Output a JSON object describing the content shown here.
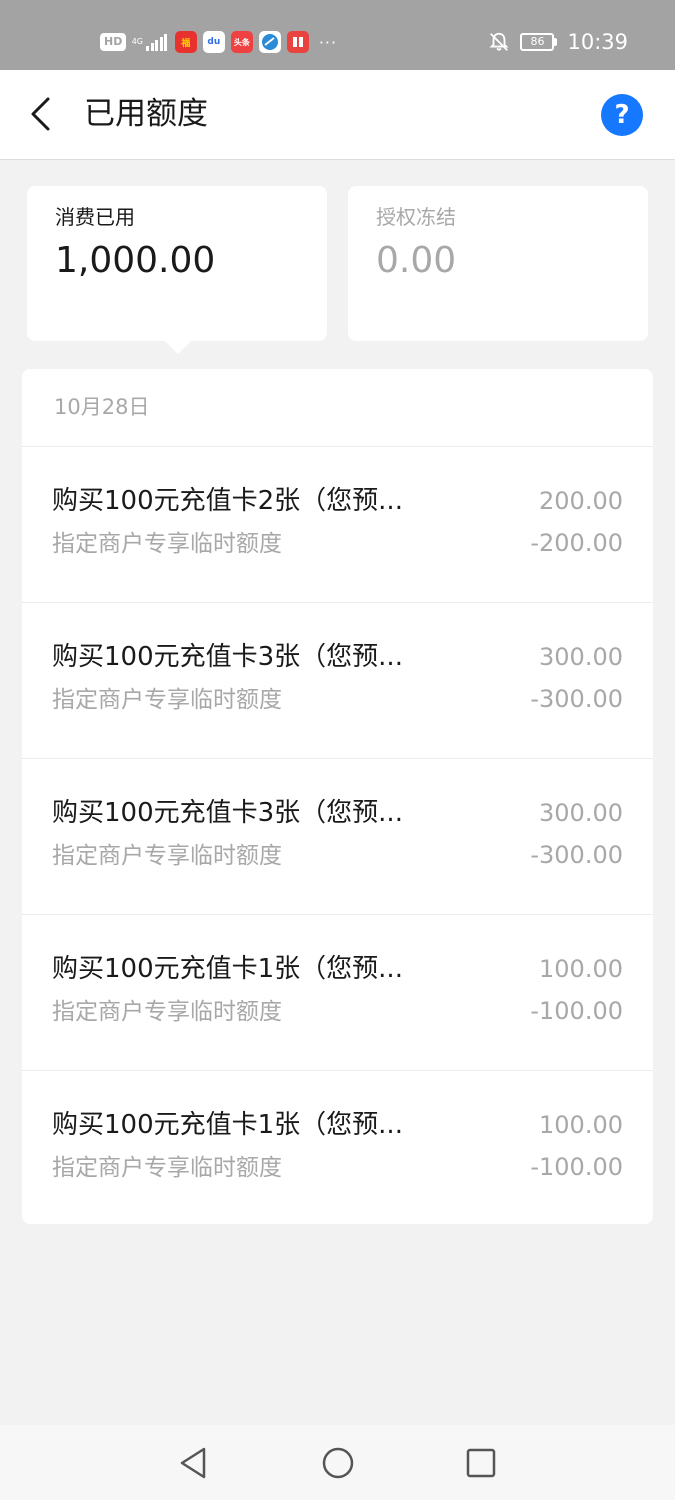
{
  "status_bar": {
    "hd": "HD",
    "network": "4G",
    "app_icons": [
      "red-app-icon",
      "baidu-icon",
      "toutiao-icon",
      "browser-icon",
      "reader-icon"
    ],
    "more": "···",
    "battery": "86",
    "time": "10:39"
  },
  "header": {
    "title": "已用额度",
    "help": "?"
  },
  "summary": {
    "used_label": "消费已用",
    "used_amount": "1,000.00",
    "frozen_label": "授权冻结",
    "frozen_amount": "0.00"
  },
  "list": {
    "date": "10月28日",
    "items": [
      {
        "name": "购买100元充值卡2张（您预...",
        "sub": "指定商户专享临时额度",
        "amount": "200.00",
        "limit_change": "-200.00"
      },
      {
        "name": "购买100元充值卡3张（您预...",
        "sub": "指定商户专享临时额度",
        "amount": "300.00",
        "limit_change": "-300.00"
      },
      {
        "name": "购买100元充值卡3张（您预...",
        "sub": "指定商户专享临时额度",
        "amount": "300.00",
        "limit_change": "-300.00"
      },
      {
        "name": "购买100元充值卡1张（您预...",
        "sub": "指定商户专享临时额度",
        "amount": "100.00",
        "limit_change": "-100.00"
      },
      {
        "name": "购买100元充值卡1张（您预...",
        "sub": "指定商户专享临时额度",
        "amount": "100.00",
        "limit_change": "-100.00"
      }
    ]
  },
  "colors": {
    "accent": "#1677ff",
    "status_bar": "#a3a3a3",
    "background": "#f2f2f2",
    "muted_text": "#a8a8a8"
  }
}
